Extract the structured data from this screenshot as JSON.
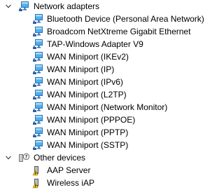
{
  "tree": {
    "categories": [
      {
        "label": "Network adapters",
        "expanded": true,
        "icon": "network-adapter-icon",
        "children": [
          {
            "label": "Bluetooth Device (Personal Area Network)",
            "icon": "network-adapter-icon"
          },
          {
            "label": "Broadcom NetXtreme Gigabit Ethernet",
            "icon": "network-adapter-icon"
          },
          {
            "label": "TAP-Windows Adapter V9",
            "icon": "network-adapter-icon"
          },
          {
            "label": "WAN Miniport (IKEv2)",
            "icon": "network-adapter-icon"
          },
          {
            "label": "WAN Miniport (IP)",
            "icon": "network-adapter-icon"
          },
          {
            "label": "WAN Miniport (IPv6)",
            "icon": "network-adapter-icon"
          },
          {
            "label": "WAN Miniport (L2TP)",
            "icon": "network-adapter-icon"
          },
          {
            "label": "WAN Miniport (Network Monitor)",
            "icon": "network-adapter-icon"
          },
          {
            "label": "WAN Miniport (PPPOE)",
            "icon": "network-adapter-icon"
          },
          {
            "label": "WAN Miniport (PPTP)",
            "icon": "network-adapter-icon"
          },
          {
            "label": "WAN Miniport (SSTP)",
            "icon": "network-adapter-icon"
          }
        ]
      },
      {
        "label": "Other devices",
        "expanded": true,
        "icon": "unknown-device-icon",
        "children": [
          {
            "label": "AAP Server",
            "icon": "unknown-device-warning-icon"
          },
          {
            "label": "Wireless iAP",
            "icon": "unknown-device-warning-icon"
          }
        ]
      }
    ]
  },
  "colors": {
    "monitor_frame": "#2a6fb5",
    "monitor_screen": "#4fb0ea",
    "monitor_screen_light": "#a9dcf7",
    "cable": "#2b5fa0",
    "chevron": "#404040",
    "warning": "#f2c300",
    "device_body": "#5a5a5a"
  }
}
